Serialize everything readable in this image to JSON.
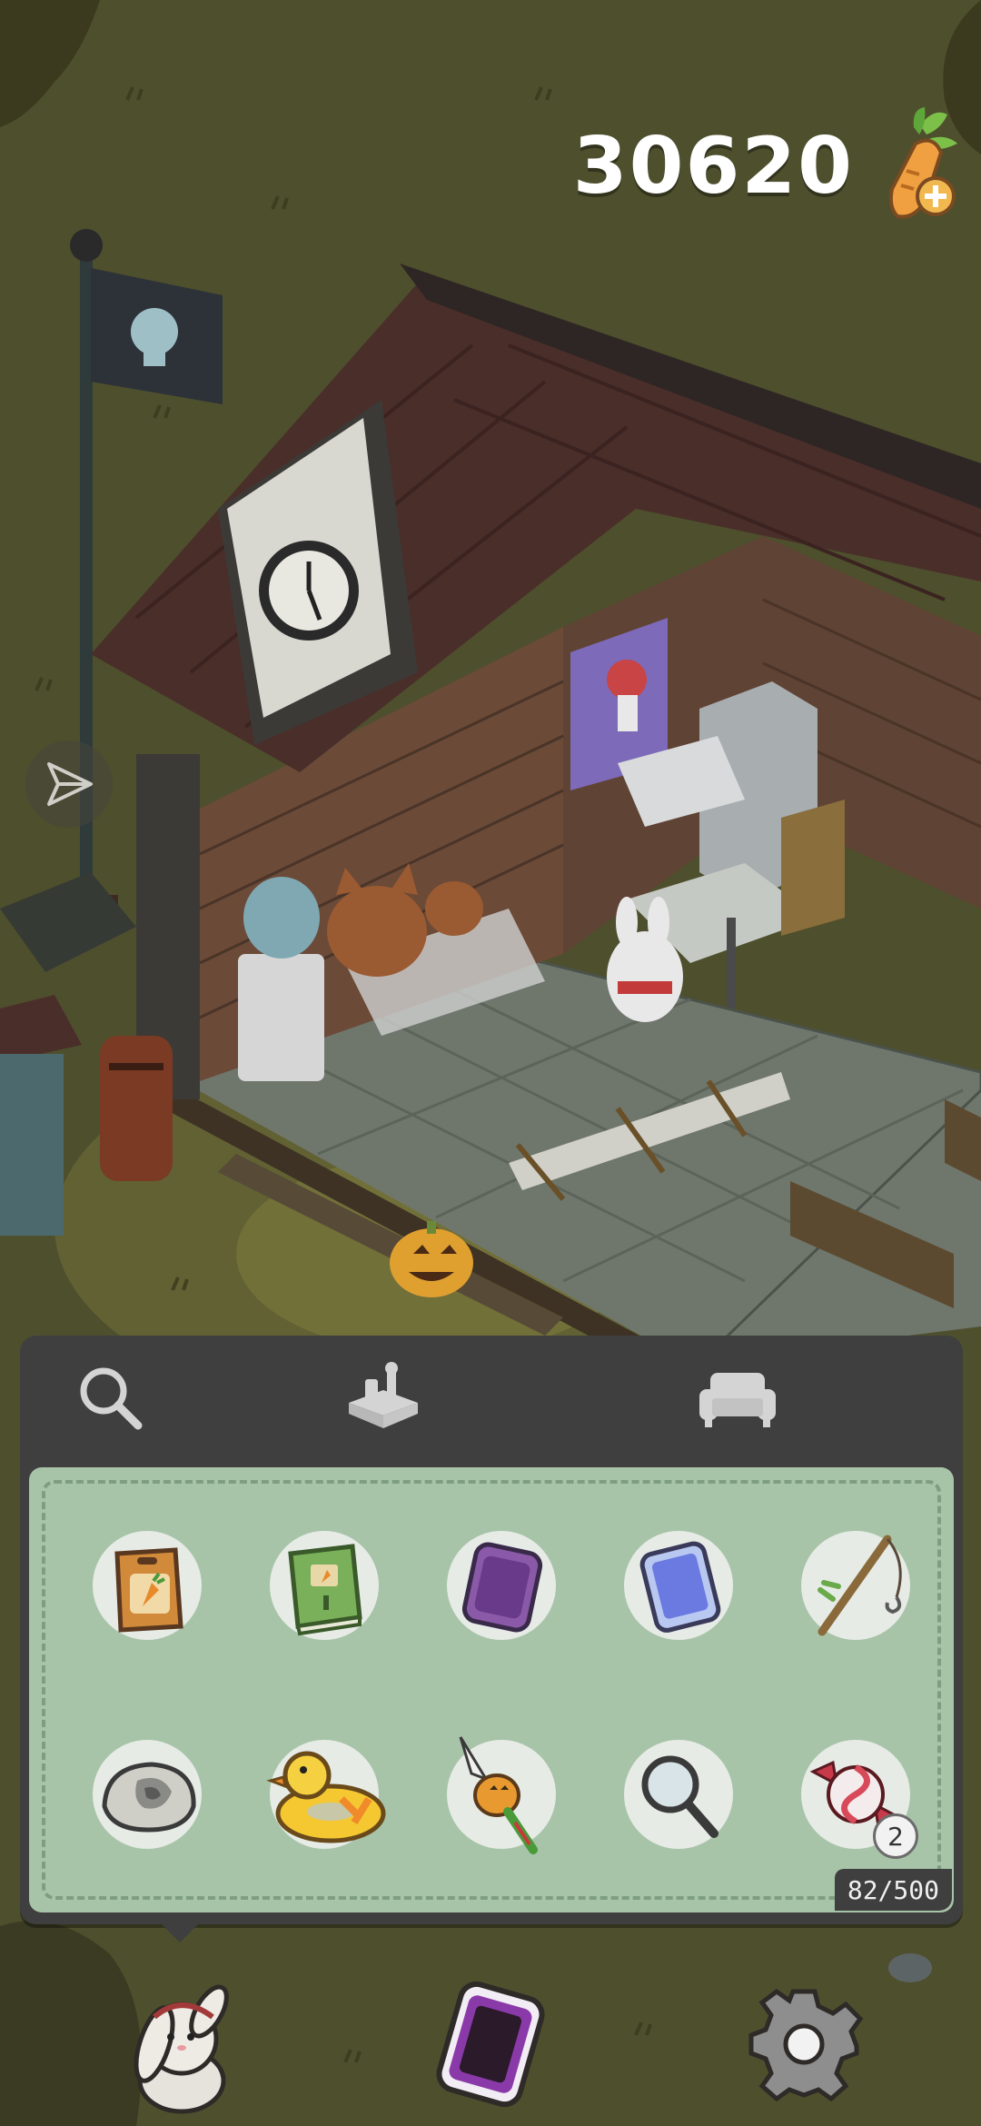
{
  "hud": {
    "currency_value": "30620",
    "currency_icon": "carrot-plus-icon",
    "share_icon": "paper-plane-icon"
  },
  "inventory": {
    "tabs": [
      {
        "name": "search",
        "icon": "magnifier-icon"
      },
      {
        "name": "crafting",
        "icon": "crafting-box-icon"
      },
      {
        "name": "furniture",
        "icon": "sofa-icon"
      }
    ],
    "items": [
      {
        "name": "carrot-seed-packet",
        "icon": "seed-packet-icon",
        "count": ""
      },
      {
        "name": "green-book",
        "icon": "book-icon",
        "count": ""
      },
      {
        "name": "purple-tablet",
        "icon": "purple-tablet-icon",
        "count": ""
      },
      {
        "name": "blue-phone",
        "icon": "blue-phone-icon",
        "count": ""
      },
      {
        "name": "fishing-rod",
        "icon": "fishing-rod-icon",
        "count": ""
      },
      {
        "name": "fossil-rock",
        "icon": "fossil-icon",
        "count": ""
      },
      {
        "name": "rubber-duck-float",
        "icon": "duck-float-icon",
        "count": ""
      },
      {
        "name": "pumpkin-wand",
        "icon": "pumpkin-wand-icon",
        "count": ""
      },
      {
        "name": "magnifying-glass",
        "icon": "magnifying-glass-icon",
        "count": ""
      },
      {
        "name": "candy",
        "icon": "candy-icon",
        "count": "2"
      }
    ],
    "capacity": "82/500"
  },
  "nav": {
    "character_icon": "bunny-avatar-icon",
    "phone_icon": "phone-icon",
    "settings_icon": "gear-icon"
  },
  "colors": {
    "ground": "#4e4f2d",
    "panel": "#3f3f3f",
    "grid": "#a8c4a8",
    "roof": "#4a2e2a",
    "brick": "#6b4a38"
  }
}
